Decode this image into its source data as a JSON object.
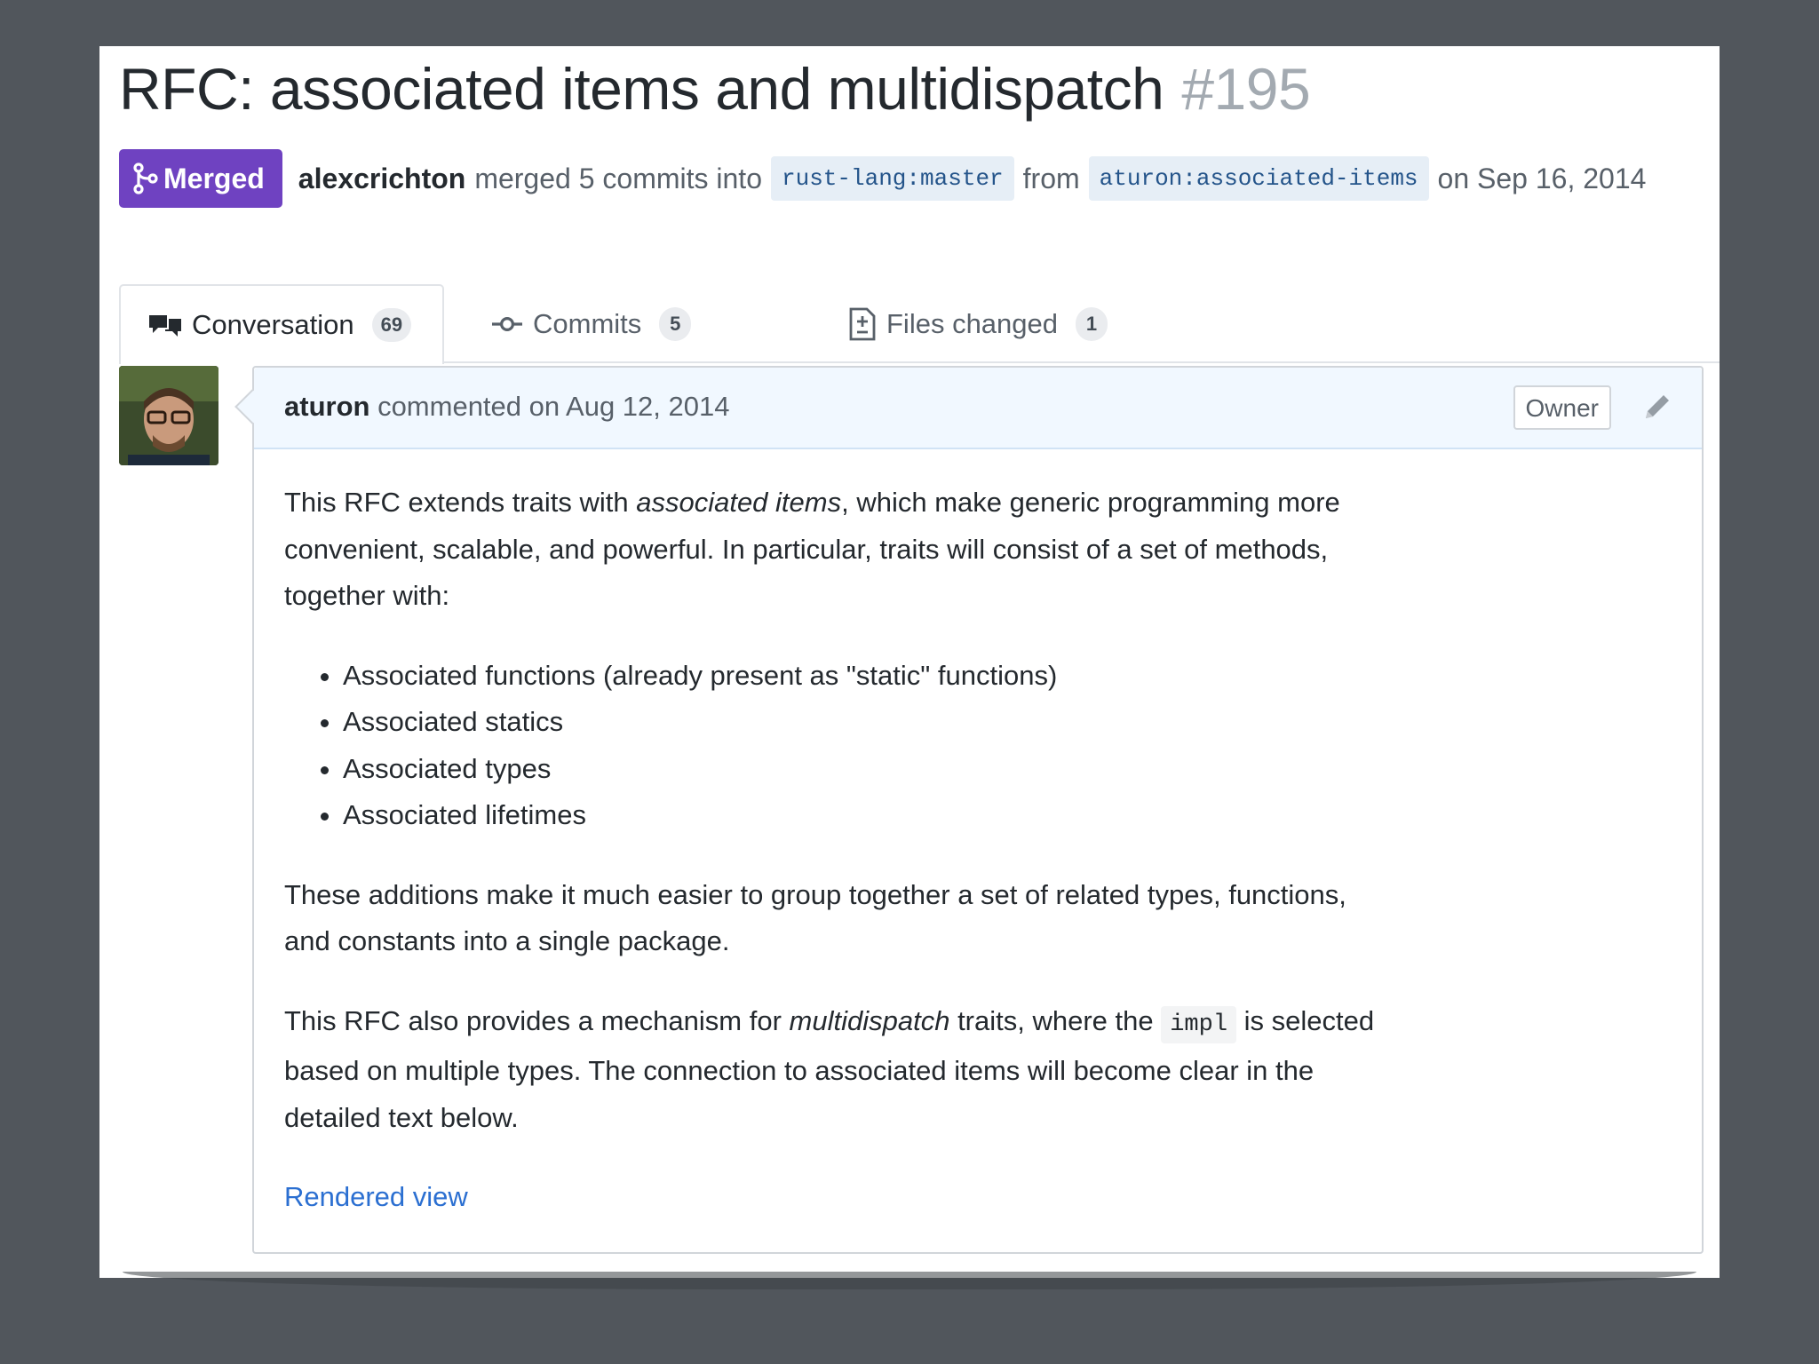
{
  "pr": {
    "title": "RFC: associated items and multidispatch",
    "number": "#195",
    "state": "Merged",
    "state_color": "#6f42c1",
    "merged_by": "alexcrichton",
    "merge_text": "merged 5 commits into",
    "base_repo": "rust-lang",
    "base_branch": "master",
    "from_text": "from",
    "head_repo": "aturon",
    "head_branch": "associated-items",
    "date_text": "on Sep 16, 2014"
  },
  "tabs": [
    {
      "label": "Conversation",
      "count": "69",
      "icon": "comment-discussion-icon",
      "selected": true
    },
    {
      "label": "Commits",
      "count": "5",
      "icon": "git-commit-icon",
      "selected": false
    },
    {
      "label": "Files changed",
      "count": "1",
      "icon": "file-diff-icon",
      "selected": false
    }
  ],
  "comment": {
    "author": "aturon",
    "action": "commented on Aug 12, 2014",
    "badge": "Owner",
    "edit_icon": "pencil-icon",
    "p1_a": "This RFC extends traits with ",
    "p1_em": "associated items",
    "p1_b": ", which make generic programming more convenient, scalable, and powerful. In particular, traits will consist of a set of methods, together with:",
    "list": [
      "Associated functions (already present as \"static\" functions)",
      "Associated statics",
      "Associated types",
      "Associated lifetimes"
    ],
    "p2": "These additions make it much easier to group together a set of related types, functions, and constants into a single package.",
    "p3_a": "This RFC also provides a mechanism for ",
    "p3_em": "multidispatch",
    "p3_b": " traits, where the ",
    "p3_code": "impl",
    "p3_c": " is selected based on multiple types. The connection to associated items will become clear in the detailed text below.",
    "link": "Rendered view"
  },
  "colors": {
    "background": "#51565c",
    "link": "#2b6fd1",
    "header_bg": "#f1f8ff"
  }
}
